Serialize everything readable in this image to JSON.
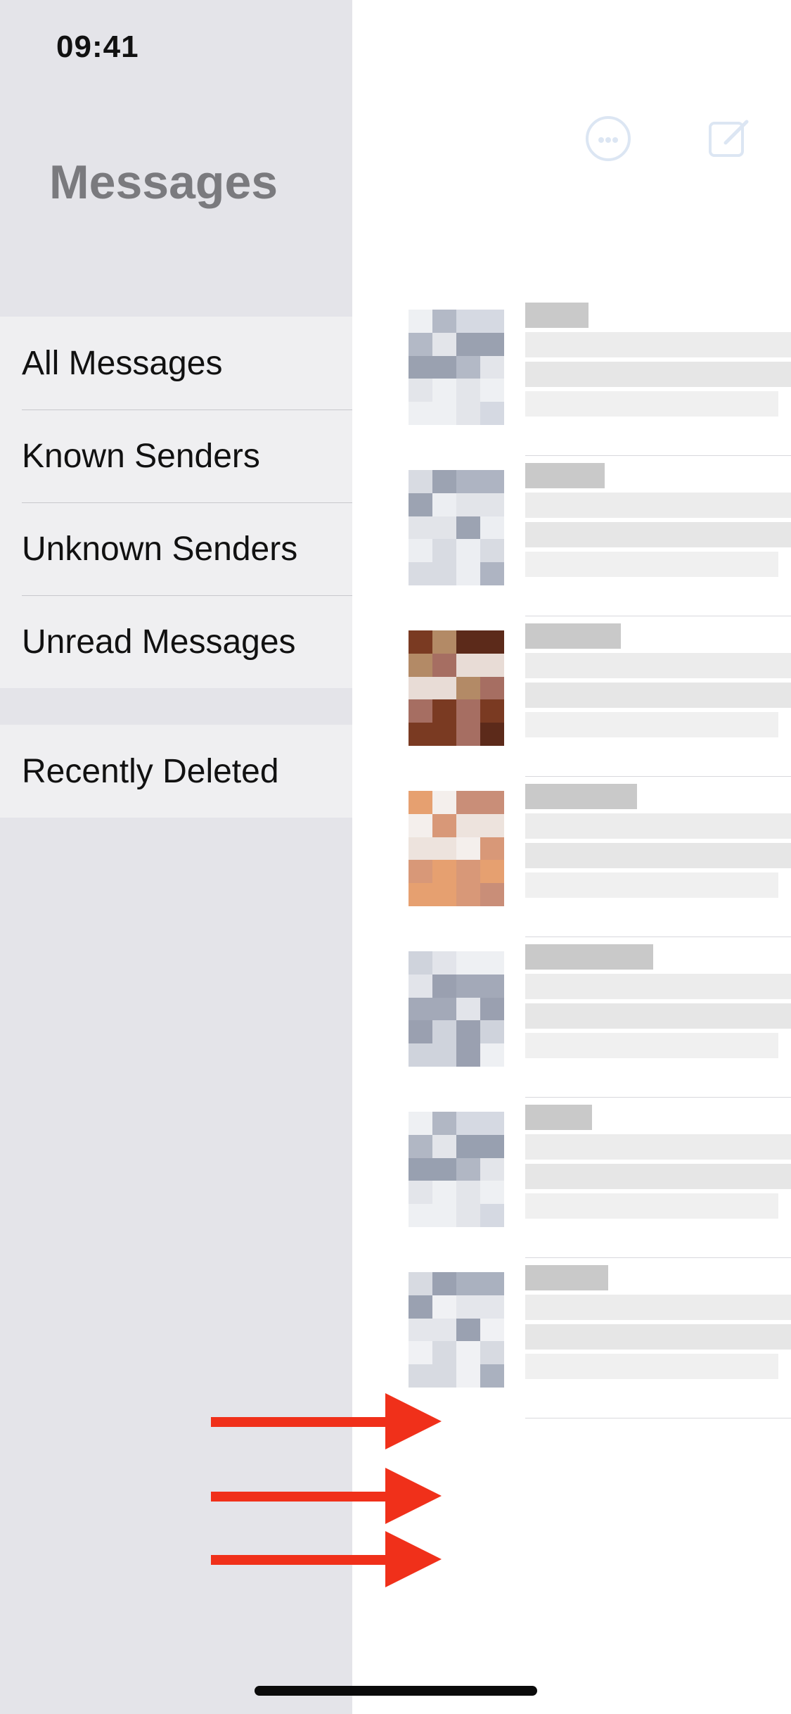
{
  "status_bar": {
    "time": "09:41"
  },
  "sidebar": {
    "title": "Messages",
    "filters": [
      {
        "label": "All Messages"
      },
      {
        "label": "Known Senders"
      },
      {
        "label": "Unknown Senders"
      },
      {
        "label": "Unread Messages"
      }
    ],
    "extra": [
      {
        "label": "Recently Deleted"
      }
    ]
  },
  "main": {
    "toolbar_icons": [
      "more-options-icon",
      "compose-icon"
    ],
    "conversations_visible": 7,
    "content_note": "conversation rows are pixelated/obscured"
  },
  "annotations": {
    "arrow_color": "#f0301a",
    "arrow_count": 3
  },
  "colors": {
    "sidebar_bg": "#e4e4e9",
    "group_bg": "#efeff1",
    "accent_faded": "#dce6f3"
  }
}
